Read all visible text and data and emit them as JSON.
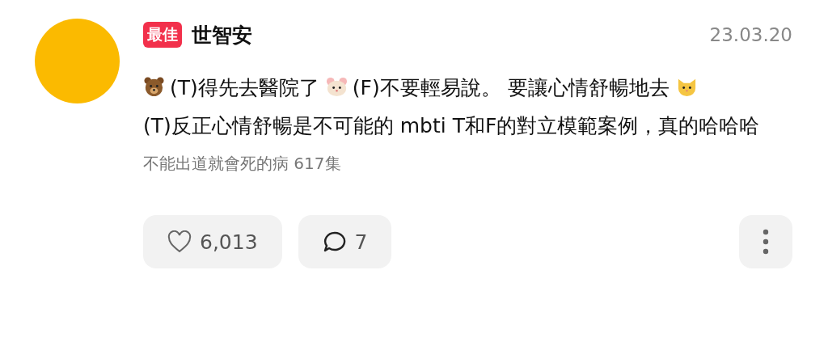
{
  "author": {
    "badge": "最佳",
    "name": "世智安"
  },
  "date": "23.03.20",
  "comment": [
    {
      "kind": "bear"
    },
    {
      "kind": "text",
      "text": "(T)得先去醫院了"
    },
    {
      "kind": "hamster"
    },
    {
      "kind": "text",
      "text": "(F)不要輕易說。 要讓心情舒暢地"
    },
    {
      "kind": "text",
      "text": "去"
    },
    {
      "kind": "cat"
    },
    {
      "kind": "text",
      "text": "(T)反正心情舒暢是不可能的 mbti T和F的對立模範"
    },
    {
      "kind": "text",
      "text": "案例，真的哈哈哈"
    }
  ],
  "source": "不能出道就會死的病 617集",
  "actions": {
    "likes": "6,013",
    "comments": "7"
  }
}
